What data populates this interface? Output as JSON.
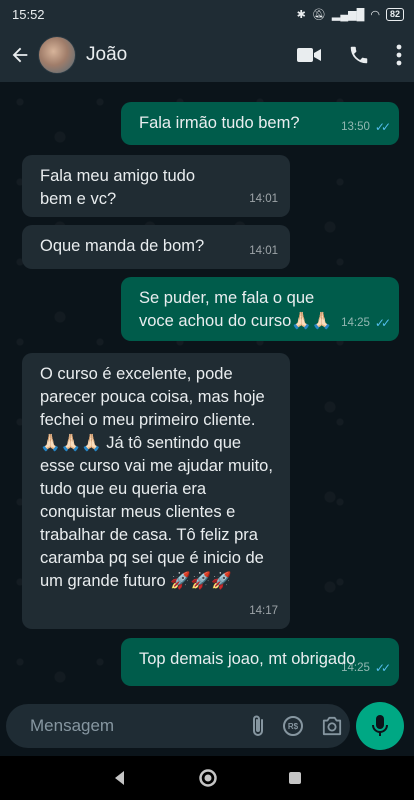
{
  "status_bar": {
    "time": "15:52",
    "battery": "82"
  },
  "header": {
    "contact_name": "João"
  },
  "messages": [
    {
      "direction": "out",
      "text": "Fala irmão tudo bem?",
      "time": "13:50",
      "read": true
    },
    {
      "direction": "in",
      "text": "Fala meu amigo tudo bem e vc?",
      "time": "14:01"
    },
    {
      "direction": "in",
      "text": "Oque manda de bom?",
      "time": "14:01"
    },
    {
      "direction": "out",
      "text": "Se puder, me fala o que voce achou do curso🙏🏻🙏🏻",
      "time": "14:25",
      "read": true
    },
    {
      "direction": "in",
      "text": "O curso é excelente, pode parecer pouca coisa, mas hoje fechei o meu primeiro cliente. 🙏🏻🙏🏻🙏🏻 Já tô sentindo que esse curso vai me ajudar muito, tudo que eu queria era conquistar meus clientes e trabalhar de casa. Tô feliz pra caramba pq sei que é inicio de um grande futuro 🚀🚀🚀",
      "time": "14:17"
    },
    {
      "direction": "out",
      "text": "Top demais joao, mt obrigado",
      "time": "14:25",
      "read": true
    }
  ],
  "composer": {
    "placeholder": "Mensagem"
  },
  "colors": {
    "outgoing": "#005c4b",
    "incoming": "#202c33",
    "accent": "#00a884",
    "read_tick": "#53bdeb"
  }
}
